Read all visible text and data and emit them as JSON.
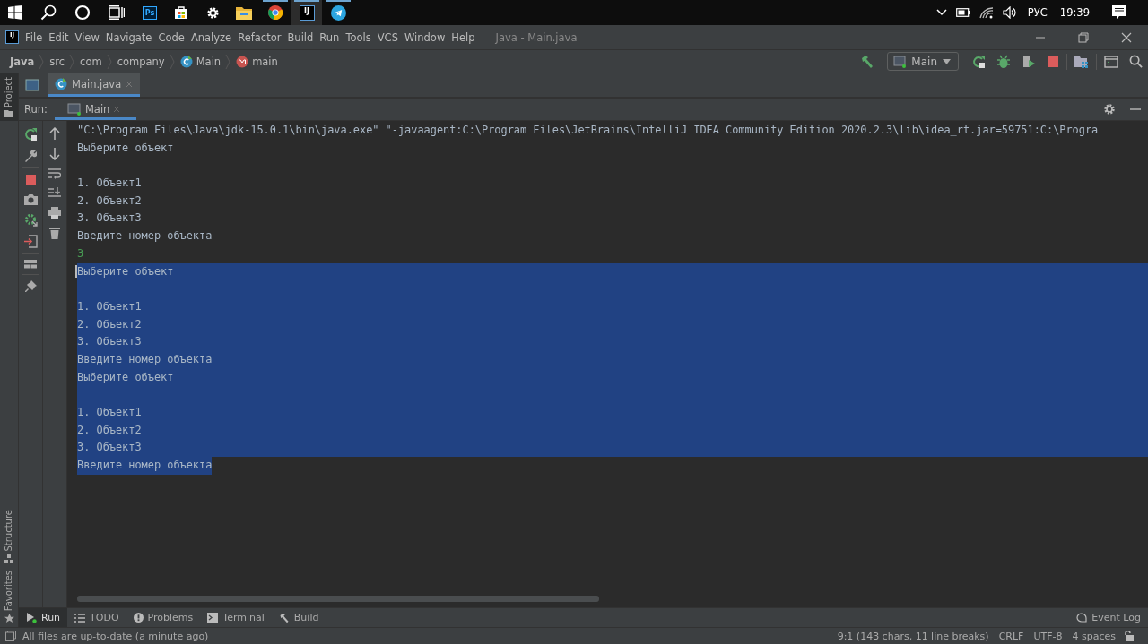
{
  "taskbar": {
    "system_buttons": [
      {
        "kind": "start"
      },
      {
        "kind": "search"
      },
      {
        "kind": "cortana"
      },
      {
        "kind": "taskview"
      }
    ],
    "apps": [
      {
        "kind": "photoshop",
        "text": "Ps",
        "running": false,
        "active": false
      },
      {
        "kind": "store",
        "running": false,
        "active": false
      },
      {
        "kind": "settings",
        "running": false,
        "active": false
      },
      {
        "kind": "folder",
        "running": false,
        "active": false
      },
      {
        "kind": "chrome",
        "running": true,
        "active": false
      },
      {
        "kind": "intellij",
        "text": "IJ",
        "running": true,
        "active": true
      },
      {
        "kind": "telegram",
        "running": true,
        "active": false
      }
    ],
    "language": "РУС",
    "time": "19:39"
  },
  "menu_bar": {
    "logo": "IJ",
    "items": [
      "File",
      "Edit",
      "View",
      "Navigate",
      "Code",
      "Analyze",
      "Refactor",
      "Build",
      "Run",
      "Tools",
      "VCS",
      "Window",
      "Help"
    ],
    "title": "Java - Main.java"
  },
  "nav_bar": {
    "breadcrumbs": [
      {
        "label": "Java",
        "kind": "root"
      },
      {
        "label": "src",
        "kind": "plain"
      },
      {
        "label": "com",
        "kind": "plain"
      },
      {
        "label": "company",
        "kind": "plain"
      },
      {
        "label": "Main",
        "kind": "class"
      },
      {
        "label": "main",
        "kind": "method"
      }
    ],
    "run_config": "Main"
  },
  "editor_tabs": [
    {
      "label": "Main.java",
      "selected": true
    }
  ],
  "side_strip": {
    "top": [
      "Project"
    ],
    "bottom": [
      "Structure",
      "Favorites"
    ]
  },
  "run_panel": {
    "label": "Run:",
    "tabs": [
      {
        "label": "Main",
        "selected": true
      }
    ]
  },
  "console": {
    "lines": [
      {
        "kind": "output",
        "text": "\"C:\\Program Files\\Java\\jdk-15.0.1\\bin\\java.exe\" \"-javaagent:C:\\Program Files\\JetBrains\\IntelliJ IDEA Community Edition 2020.2.3\\lib\\idea_rt.jar=59751:C:\\Progra",
        "selected": false
      },
      {
        "kind": "output",
        "text": "Выберите объект",
        "selected": false
      },
      {
        "kind": "blank",
        "selected": false
      },
      {
        "kind": "output",
        "text": "1. Объект1",
        "selected": false
      },
      {
        "kind": "output",
        "text": "2. Объект2",
        "selected": false
      },
      {
        "kind": "output",
        "text": "3. Объект3",
        "selected": false
      },
      {
        "kind": "output",
        "text": "Введите номер объекта",
        "selected": false
      },
      {
        "kind": "input",
        "text": "3",
        "selected": false
      },
      {
        "kind": "output",
        "text": "Выберите объект",
        "selected": true
      },
      {
        "kind": "blank",
        "selected": true
      },
      {
        "kind": "output",
        "text": "1. Объект1",
        "selected": true
      },
      {
        "kind": "output",
        "text": "2. Объект2",
        "selected": true
      },
      {
        "kind": "output",
        "text": "3. Объект3",
        "selected": true
      },
      {
        "kind": "output",
        "text": "Введите номер объекта",
        "selected": true
      },
      {
        "kind": "output",
        "text": "Выберите объект",
        "selected": true
      },
      {
        "kind": "blank",
        "selected": true
      },
      {
        "kind": "output",
        "text": "1. Объект1",
        "selected": true
      },
      {
        "kind": "output",
        "text": "2. Объект2",
        "selected": true
      },
      {
        "kind": "output",
        "text": "3. Объект3",
        "selected": true
      },
      {
        "kind": "output",
        "text": "Введите номер объекта",
        "selected": true
      }
    ]
  },
  "tool_tabs": [
    {
      "label": "Run",
      "kind": "run",
      "selected": true
    },
    {
      "label": "TODO",
      "kind": "todo",
      "selected": false
    },
    {
      "label": "Problems",
      "kind": "problems",
      "selected": false
    },
    {
      "label": "Terminal",
      "kind": "terminal",
      "selected": false
    },
    {
      "label": "Build",
      "kind": "build",
      "selected": false
    }
  ],
  "event_log": "Event Log",
  "status_bar": {
    "message": "All files are up-to-date (a minute ago)",
    "items": [
      "9:1 (143 chars, 11 line breaks)",
      "CRLF",
      "UTF-8",
      "4 spaces"
    ]
  }
}
